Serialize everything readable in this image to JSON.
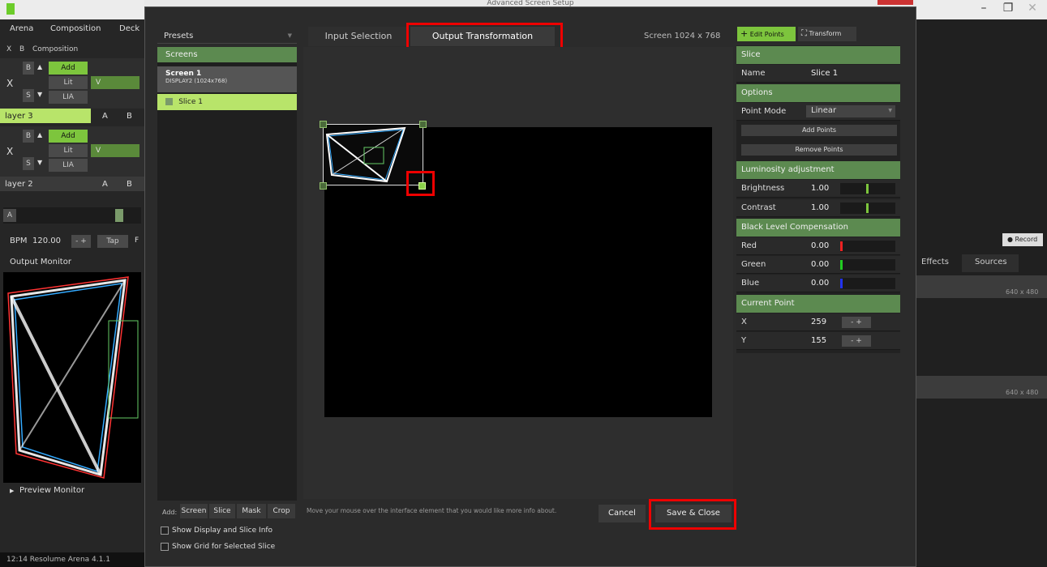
{
  "window": {
    "title": "Advanced Screen Setup",
    "minimize": "–",
    "restore": "❐",
    "close": "✕"
  },
  "app": {
    "menu": [
      "Arena",
      "Composition",
      "Deck"
    ],
    "xb": {
      "x": "X",
      "b": "B",
      "composition": "Composition"
    },
    "layers": [
      {
        "name": "layer 3",
        "a": "A",
        "b": "B"
      },
      {
        "name": "layer 2",
        "a": "A",
        "b": "B"
      }
    ],
    "controls": {
      "b": "B",
      "s": "S",
      "add": "Add",
      "lit": "Lit",
      "lia": "LIA",
      "v": "V",
      "x": "X"
    },
    "deck_a": "A",
    "bpm_label": "BPM",
    "bpm_value": "120.00",
    "bpm_stepper": "- +",
    "tap": "Tap",
    "tap_f": "F",
    "output_monitor": "Output Monitor",
    "preview_monitor": "Preview Monitor",
    "status": "12:14  Resolume Arena 4.1.1",
    "right": {
      "record": "Record",
      "effects": "Effects",
      "sources": "Sources",
      "res1": "640 x 480",
      "res2": "640 x 480"
    }
  },
  "dialog": {
    "presets": "Presets",
    "screens_header": "Screens",
    "screen": {
      "name": "Screen 1",
      "display": "DISPLAY2 (1024x768)"
    },
    "slice": {
      "name": "Slice 1"
    },
    "tabs": [
      {
        "label": "Input Selection"
      },
      {
        "label": "Output Transformation"
      }
    ],
    "screen_info": "Screen  1024 x 768",
    "edit_points": "Edit Points",
    "transform": "Transform",
    "panel": {
      "slice_hdr": "Slice",
      "name_label": "Name",
      "name_value": "Slice 1",
      "options_hdr": "Options",
      "point_mode_label": "Point Mode",
      "point_mode_value": "Linear",
      "add_points": "Add Points",
      "remove_points": "Remove Points",
      "lum_hdr": "Luminosity adjustment",
      "brightness_label": "Brightness",
      "brightness_value": "1.00",
      "contrast_label": "Contrast",
      "contrast_value": "1.00",
      "blc_hdr": "Black Level Compensation",
      "red_label": "Red",
      "red_value": "0.00",
      "green_label": "Green",
      "green_value": "0.00",
      "blue_label": "Blue",
      "blue_value": "0.00",
      "current_point_hdr": "Current Point",
      "x_label": "X",
      "x_value": "259",
      "y_label": "Y",
      "y_value": "155",
      "stepper": "-  +"
    },
    "add_label": "Add:",
    "add_buttons": [
      "Screen",
      "Slice",
      "Mask",
      "Crop"
    ],
    "hint": "Move your mouse over the interface element that you would like more info about.",
    "cancel": "Cancel",
    "save_close": "Save & Close",
    "show_display_info": "Show Display and Slice Info",
    "show_grid": "Show Grid for Selected Slice"
  },
  "colors": {
    "accent": "#7dc53d",
    "highlight": "#e00000",
    "header_green": "#5c8a50"
  }
}
